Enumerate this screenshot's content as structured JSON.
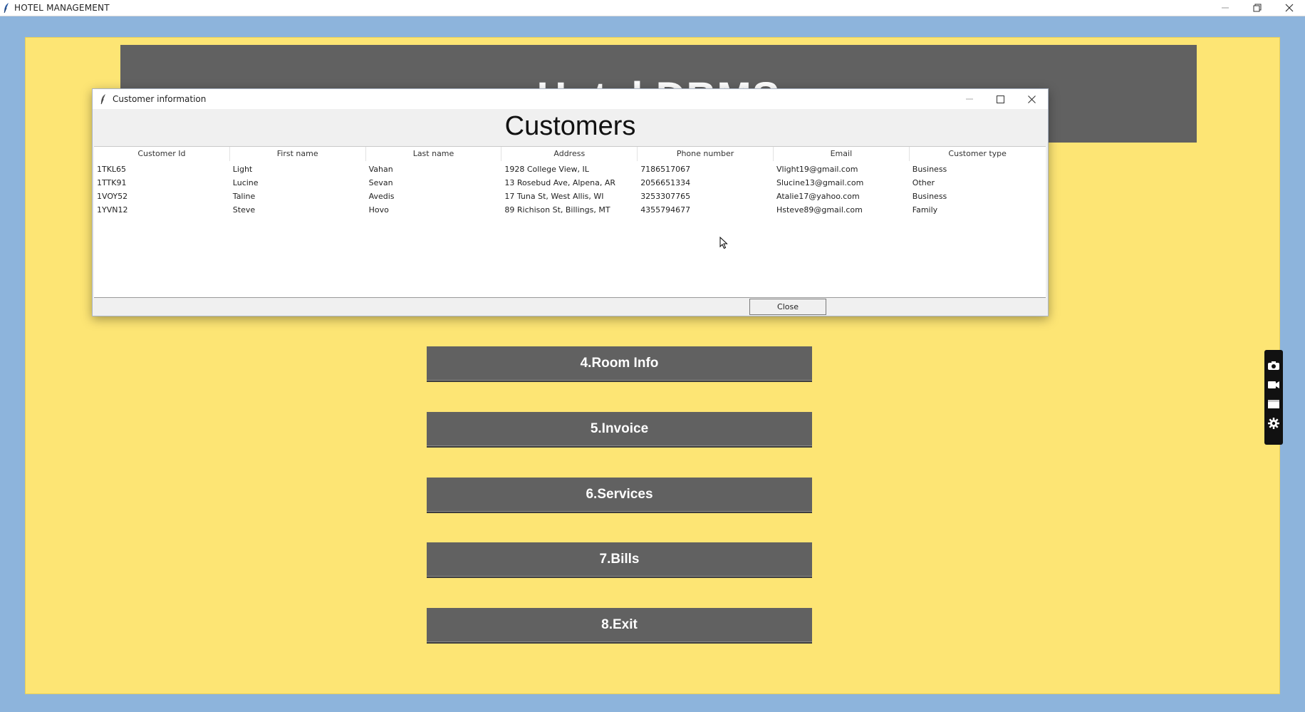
{
  "main_window": {
    "title": "HOTEL MANAGEMENT",
    "banner_title": "Hotel DBMS",
    "menu_buttons": [
      {
        "label": "4.Room Info"
      },
      {
        "label": "5.Invoice"
      },
      {
        "label": "6.Services"
      },
      {
        "label": "7.Bills"
      },
      {
        "label": "8.Exit"
      }
    ]
  },
  "dialog": {
    "title": "Customer information",
    "heading": "Customers",
    "columns": [
      "Customer Id",
      "First name",
      "Last name",
      "Address",
      "Phone number",
      "Email",
      "Customer type"
    ],
    "rows": [
      [
        "1TKL65",
        "Light",
        "Vahan",
        "1928 College View, IL",
        "7186517067",
        "Vlight19@gmail.com",
        "Business"
      ],
      [
        "1TTK91",
        "Lucine",
        "Sevan",
        "13 Rosebud Ave, Alpena, AR",
        "2056651334",
        "Slucine13@gmail.com",
        "Other"
      ],
      [
        "1VOY52",
        "Taline",
        "Avedis",
        "17 Tuna St, West Allis, WI",
        "3253307765",
        "Atalie17@yahoo.com",
        "Business"
      ],
      [
        "1YVN12",
        "Steve",
        "Hovo",
        "89 Richison St, Billings, MT",
        "4355794677",
        "Hsteve89@gmail.com",
        "Family"
      ]
    ],
    "close_label": "Close"
  },
  "icons": {
    "app": "feather-icon",
    "toolbar": [
      "camera-icon",
      "video-camera-icon",
      "window-icon",
      "gear-icon"
    ]
  },
  "colors": {
    "background": "#8db4dc",
    "panel": "#fde574",
    "button": "#616161"
  }
}
